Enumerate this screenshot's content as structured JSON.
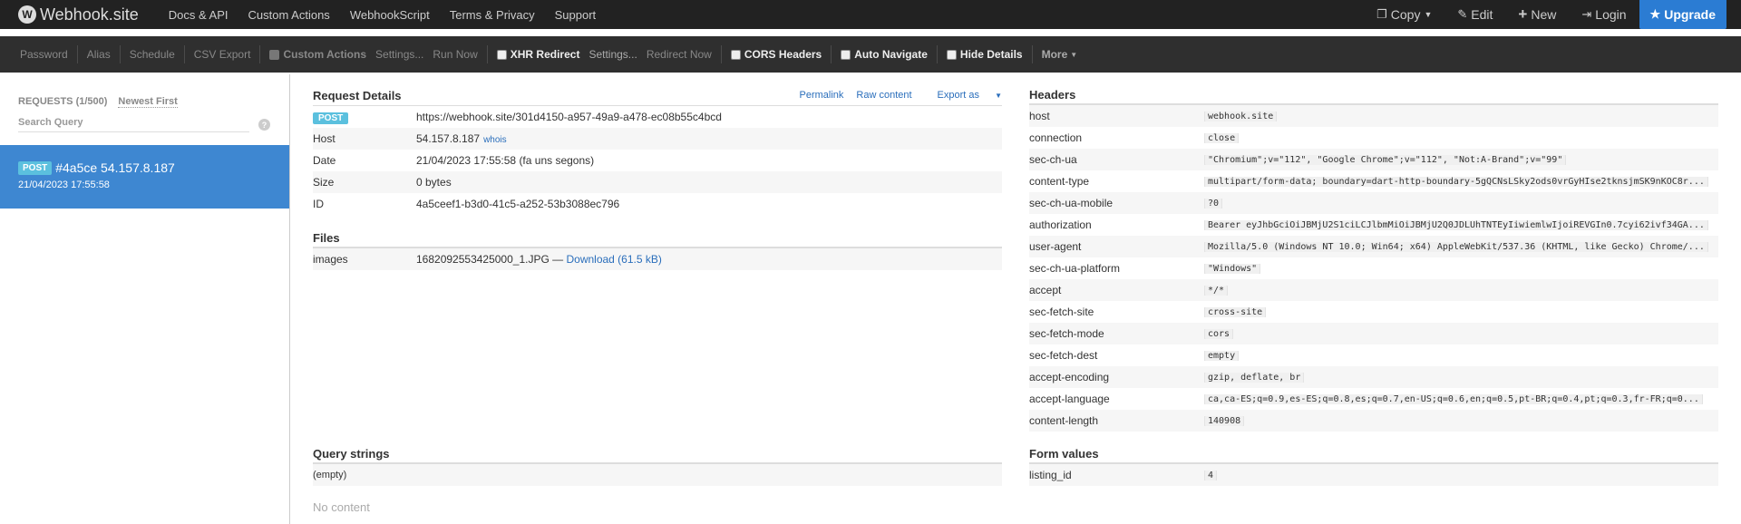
{
  "brand": {
    "name": "Webhook.site",
    "logo_char": "W"
  },
  "nav": [
    "Docs & API",
    "Custom Actions",
    "WebhookScript",
    "Terms & Privacy",
    "Support"
  ],
  "nav_right": {
    "copy": "Copy",
    "edit": "Edit",
    "new": "New",
    "login": "Login",
    "upgrade": "Upgrade"
  },
  "toolbar": {
    "password": "Password",
    "alias": "Alias",
    "schedule": "Schedule",
    "csv_export": "CSV Export",
    "custom_actions": "Custom Actions",
    "settings1": "Settings...",
    "run_now": "Run Now",
    "xhr_redirect": "XHR Redirect",
    "settings2": "Settings...",
    "redirect_now": "Redirect Now",
    "cors_headers": "CORS Headers",
    "auto_navigate": "Auto Navigate",
    "hide_details": "Hide Details",
    "more": "More"
  },
  "sidebar": {
    "requests_label": "REQUESTS (1/500)",
    "newest_first": "Newest First",
    "search_placeholder": "Search Query",
    "help": "?",
    "item": {
      "method": "POST",
      "title": "#4a5ce 54.157.8.187",
      "time": "21/04/2023 17:55:58"
    }
  },
  "request_details": {
    "title": "Request Details",
    "links": {
      "permalink": "Permalink",
      "raw": "Raw content",
      "export": "Export as"
    },
    "method": "POST",
    "url": "https://webhook.site/301d4150-a957-49a9-a478-ec08b55c4bcd",
    "rows": {
      "host_label": "Host",
      "host_value": "54.157.8.187",
      "whois": "whois",
      "date_label": "Date",
      "date_value": "21/04/2023 17:55:58 (fa uns segons)",
      "size_label": "Size",
      "size_value": "0 bytes",
      "id_label": "ID",
      "id_value": "4a5ceef1-b3d0-41c5-a252-53b3088ec796"
    }
  },
  "files": {
    "title": "Files",
    "name": "images",
    "file": "1682092553425000_1.JPG —",
    "download": "Download (61.5 kB)"
  },
  "headers": {
    "title": "Headers",
    "rows": [
      {
        "k": "host",
        "v": "webhook.site"
      },
      {
        "k": "connection",
        "v": "close"
      },
      {
        "k": "sec-ch-ua",
        "v": "\"Chromium\";v=\"112\", \"Google Chrome\";v=\"112\", \"Not:A-Brand\";v=\"99\""
      },
      {
        "k": "content-type",
        "v": "multipart/form-data; boundary=dart-http-boundary-5gQCNsLSky2ods0vrGyHIse2tknsjmSK9nKOC8r..."
      },
      {
        "k": "sec-ch-ua-mobile",
        "v": "?0"
      },
      {
        "k": "authorization",
        "v": "Bearer eyJhbGciOiJBMjU2S1ciLCJlbmMiOiJBMjU2Q0JDLUhTNTEyIiwiemlwIjoiREVGIn0.7cyi62ivf34GA..."
      },
      {
        "k": "user-agent",
        "v": "Mozilla/5.0 (Windows NT 10.0; Win64; x64) AppleWebKit/537.36 (KHTML, like Gecko) Chrome/..."
      },
      {
        "k": "sec-ch-ua-platform",
        "v": "\"Windows\""
      },
      {
        "k": "accept",
        "v": "*/*"
      },
      {
        "k": "sec-fetch-site",
        "v": "cross-site"
      },
      {
        "k": "sec-fetch-mode",
        "v": "cors"
      },
      {
        "k": "sec-fetch-dest",
        "v": "empty"
      },
      {
        "k": "accept-encoding",
        "v": "gzip, deflate, br"
      },
      {
        "k": "accept-language",
        "v": "ca,ca-ES;q=0.9,es-ES;q=0.8,es;q=0.7,en-US;q=0.6,en;q=0.5,pt-BR;q=0.4,pt;q=0.3,fr-FR;q=0..."
      },
      {
        "k": "content-length",
        "v": "140908"
      }
    ]
  },
  "query_strings": {
    "title": "Query strings",
    "empty": "(empty)"
  },
  "form_values": {
    "title": "Form values",
    "key": "listing_id",
    "value": "4"
  },
  "no_content": "No content"
}
